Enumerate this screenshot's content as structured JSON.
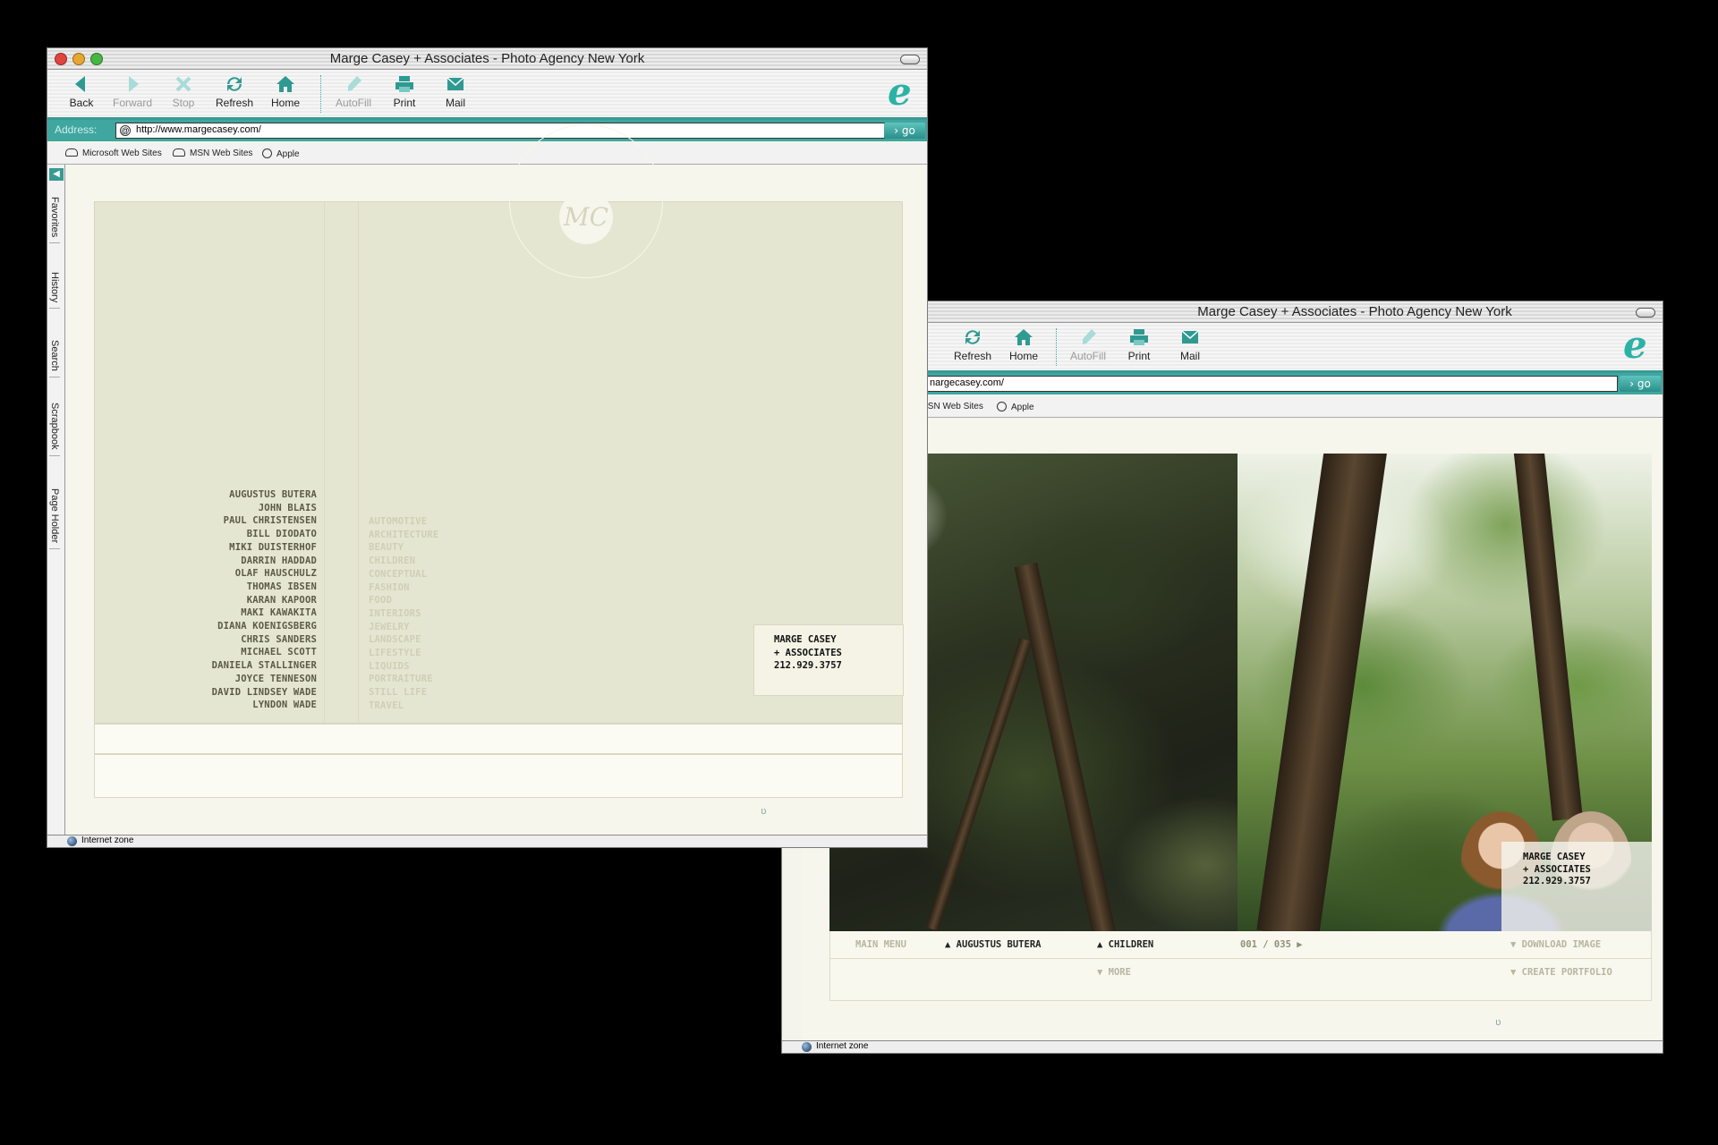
{
  "colors": {
    "accent": "#3a9a94",
    "page_bg": "#000000",
    "site_panel": "#e5e6d1"
  },
  "browser": {
    "title": "Marge Casey + Associates - Photo Agency New York",
    "toolbar": {
      "back": "Back",
      "forward": "Forward",
      "stop": "Stop",
      "refresh": "Refresh",
      "home": "Home",
      "autofill": "AutoFill",
      "print": "Print",
      "mail": "Mail"
    },
    "address_label": "Address:",
    "url": "http://www.margecasey.com/",
    "url_partial": "nargecasey.com/",
    "go": "go",
    "favorites": [
      "Microsoft Web Sites",
      "MSN Web Sites",
      "Apple"
    ],
    "favorites_partial_msn": "ISN Web Sites",
    "sidebar_tabs": [
      "Favorites",
      "History",
      "Search",
      "Scrapbook",
      "Page Holder"
    ],
    "status": "Internet zone"
  },
  "site": {
    "logo": "MC",
    "photographers": [
      "AUGUSTUS BUTERA",
      "JOHN BLAIS",
      "PAUL CHRISTENSEN",
      "BILL DIODATO",
      "MIKI DUISTERHOF",
      "DARRIN HADDAD",
      "OLAF HAUSCHULZ",
      "THOMAS IBSEN",
      "KARAN KAPOOR",
      "MAKI KAWAKITA",
      "DIANA KOENIGSBERG",
      "CHRIS SANDERS",
      "MICHAEL SCOTT",
      "DANIELA STALLINGER",
      "JOYCE TENNESON",
      "DAVID LINDSEY WADE",
      "LYNDON WADE"
    ],
    "categories": [
      "AUTOMOTIVE",
      "ARCHITECTURE",
      "BEAUTY",
      "CHILDREN",
      "CONCEPTUAL",
      "FASHION",
      "FOOD",
      "INTERIORS",
      "JEWELRY",
      "LANDSCAPE",
      "LIFESTYLE",
      "LIQUIDS",
      "PORTRAITURE",
      "STILL LIFE",
      "TRAVEL"
    ],
    "contact": {
      "line1": "MARGE CASEY",
      "line2": "+ ASSOCIATES",
      "phone": "212.929.3757"
    },
    "gallery_nav": {
      "main_menu": "MAIN MENU",
      "photographer": "▲ AUGUSTUS BUTERA",
      "category": "▲ CHILDREN",
      "counter": "001 / 035 ▶",
      "download": "▼ DOWNLOAD IMAGE",
      "more": "▼ MORE",
      "portfolio": "▼ CREATE PORTFOLIO"
    }
  }
}
